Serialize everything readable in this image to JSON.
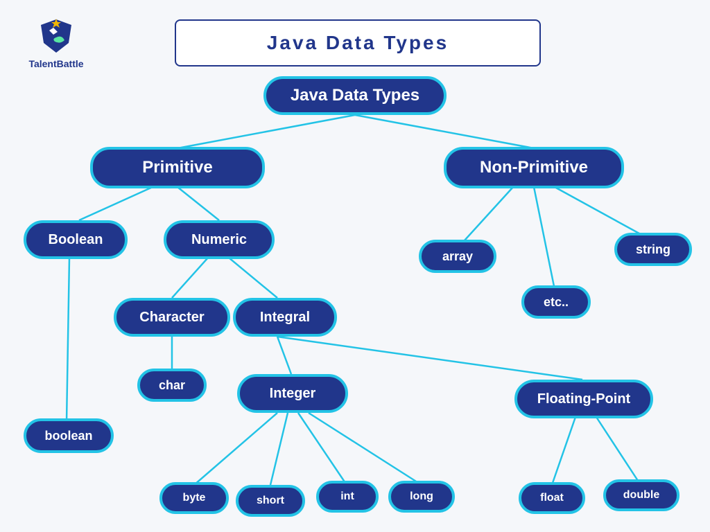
{
  "brand": {
    "name": "TalentBattle"
  },
  "title": "Java Data Types",
  "colors": {
    "fill": "#21368B",
    "border": "#23C3E6",
    "bg": "#F5F7FA"
  },
  "nodes": {
    "root": {
      "label": "Java Data Types"
    },
    "primitive": {
      "label": "Primitive"
    },
    "nonprimitive": {
      "label": "Non-Primitive"
    },
    "boolean_cat": {
      "label": "Boolean"
    },
    "numeric": {
      "label": "Numeric"
    },
    "array": {
      "label": "array"
    },
    "string": {
      "label": "string"
    },
    "etc": {
      "label": "etc.."
    },
    "character": {
      "label": "Character"
    },
    "integral": {
      "label": "Integral"
    },
    "char_leaf": {
      "label": "char"
    },
    "boolean_leaf": {
      "label": "boolean"
    },
    "integer": {
      "label": "Integer"
    },
    "floating": {
      "label": "Floating-Point"
    },
    "byte": {
      "label": "byte"
    },
    "short": {
      "label": "short"
    },
    "int": {
      "label": "int"
    },
    "long": {
      "label": "long"
    },
    "float": {
      "label": "float"
    },
    "double": {
      "label": "double"
    }
  },
  "edges": [
    [
      "root",
      "primitive"
    ],
    [
      "root",
      "nonprimitive"
    ],
    [
      "primitive",
      "boolean_cat"
    ],
    [
      "primitive",
      "numeric"
    ],
    [
      "nonprimitive",
      "array"
    ],
    [
      "nonprimitive",
      "string"
    ],
    [
      "nonprimitive",
      "etc"
    ],
    [
      "numeric",
      "character"
    ],
    [
      "numeric",
      "integral"
    ],
    [
      "character",
      "char_leaf"
    ],
    [
      "boolean_cat",
      "boolean_leaf"
    ],
    [
      "integral",
      "integer"
    ],
    [
      "integral",
      "floating"
    ],
    [
      "integer",
      "byte"
    ],
    [
      "integer",
      "short"
    ],
    [
      "integer",
      "int"
    ],
    [
      "integer",
      "long"
    ],
    [
      "floating",
      "float"
    ],
    [
      "floating",
      "double"
    ]
  ]
}
